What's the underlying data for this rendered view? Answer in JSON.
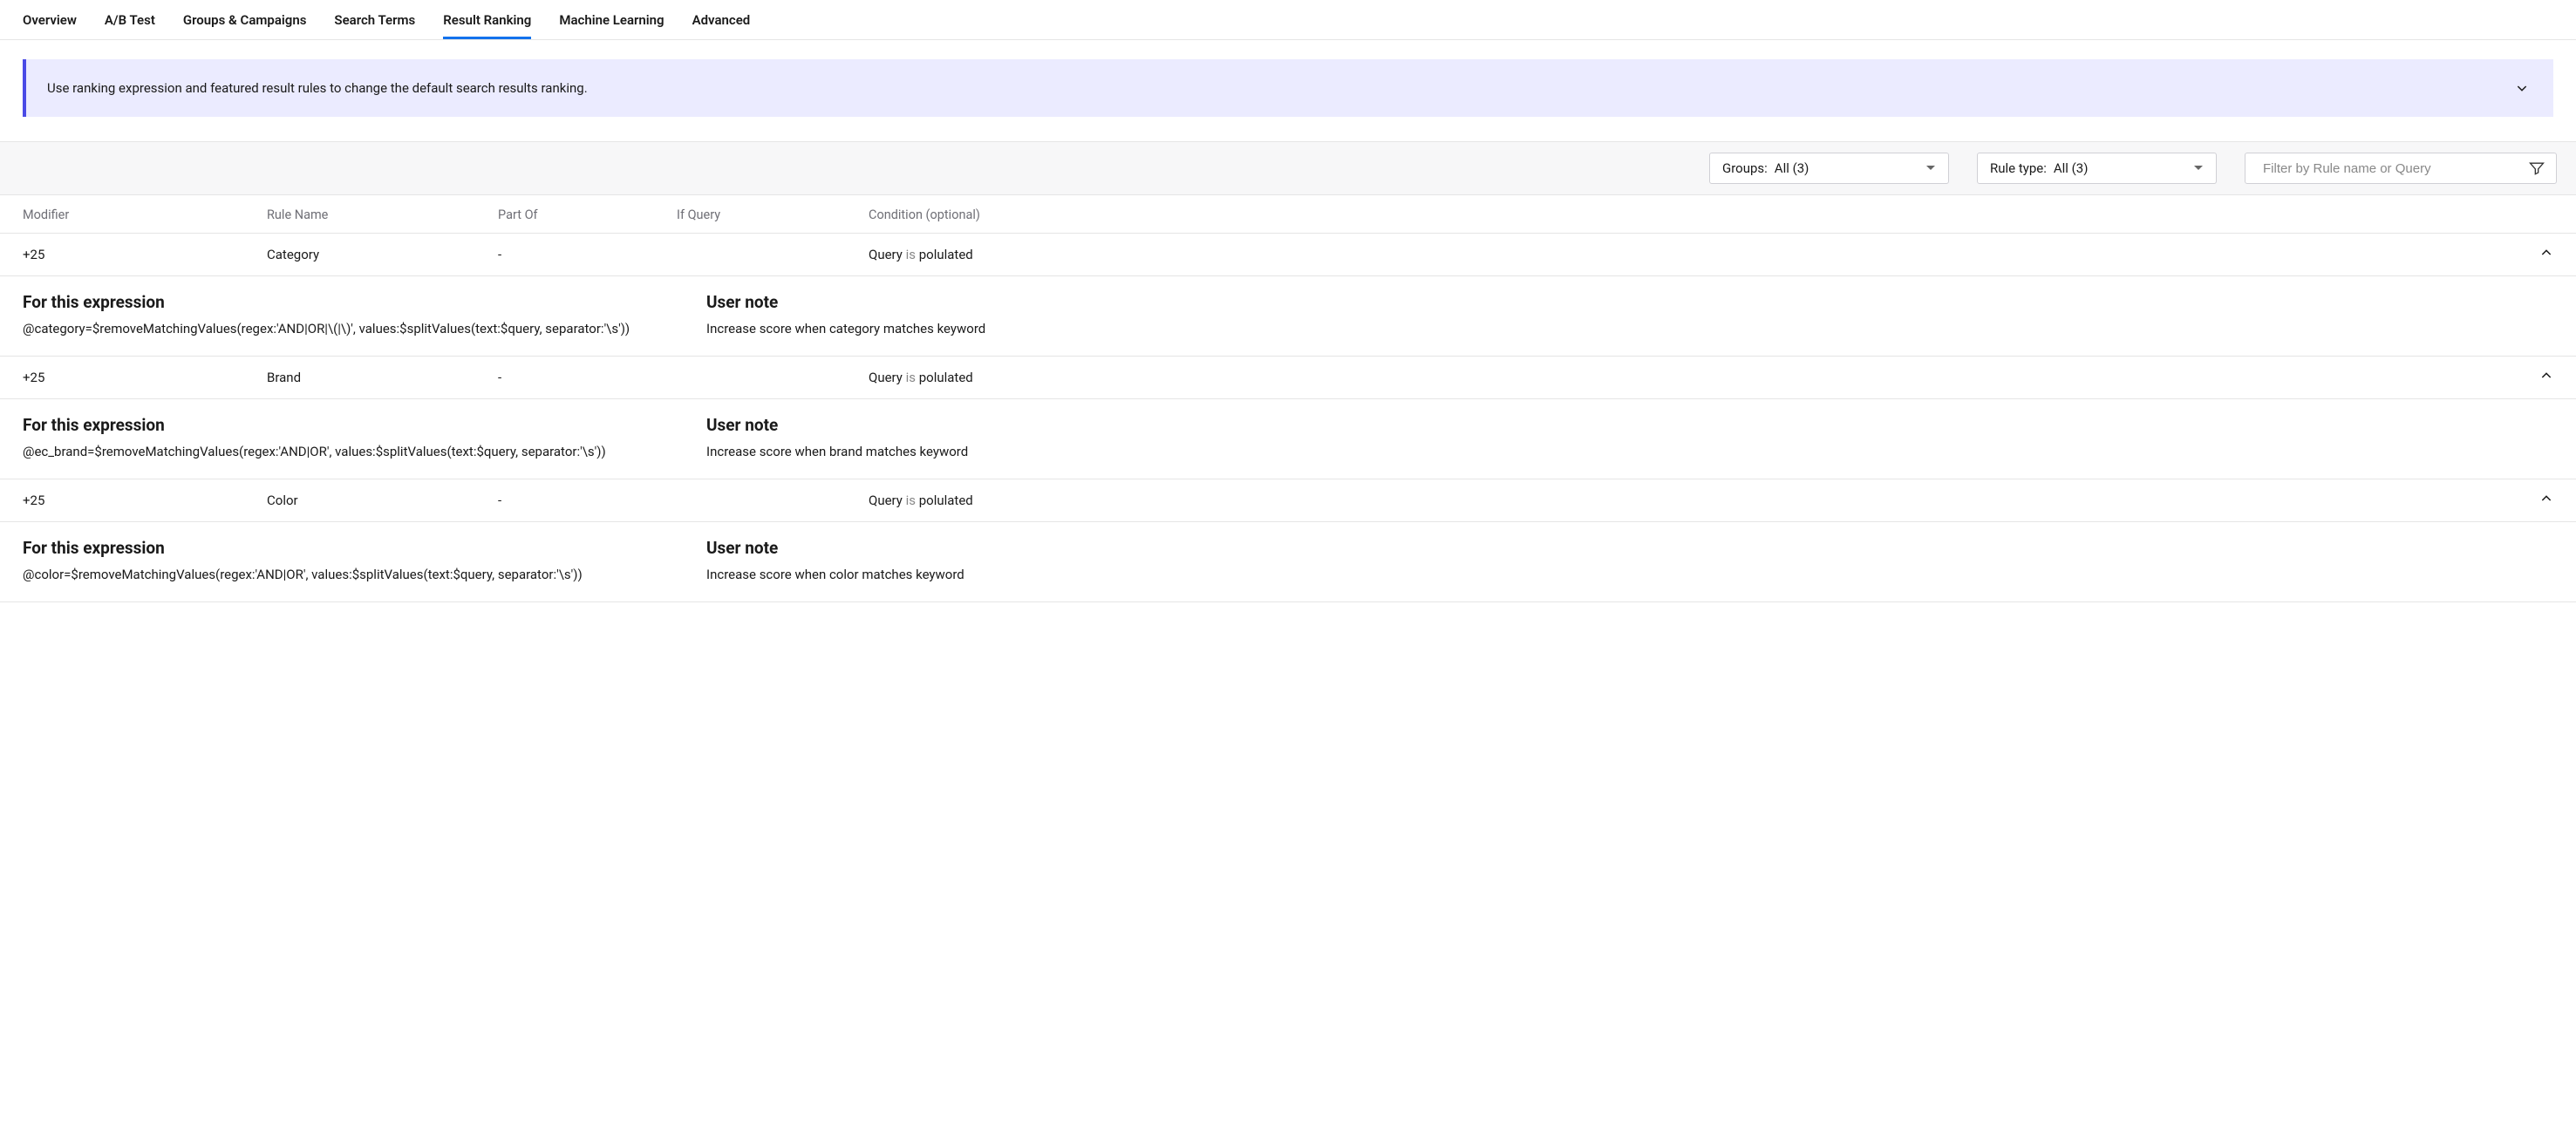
{
  "tabs": [
    "Overview",
    "A/B Test",
    "Groups & Campaigns",
    "Search Terms",
    "Result Ranking",
    "Machine Learning",
    "Advanced"
  ],
  "activeTab": "Result Ranking",
  "banner": {
    "text": "Use ranking expression and featured result rules to change the default search results ranking."
  },
  "toolbar": {
    "groupsLabel": "Groups:",
    "groupsValue": "All (3)",
    "ruleTypeLabel": "Rule type:",
    "ruleTypeValue": "All (3)",
    "filterPlaceholder": "Filter by Rule name or Query"
  },
  "columns": {
    "modifier": "Modifier",
    "ruleName": "Rule Name",
    "partOf": "Part Of",
    "ifQuery": "If Query",
    "condition": "Condition (optional)"
  },
  "detailLabels": {
    "expression": "For this expression",
    "userNote": "User note"
  },
  "rules": [
    {
      "modifier": "+25",
      "ruleName": "Category",
      "partOf": "-",
      "ifQuery": "",
      "condPrefix": "Query",
      "condIs": "is",
      "condVal": "polulated",
      "expression": "@category=$removeMatchingValues(regex:'AND|OR|\\(|\\)', values:$splitValues(text:$query, separator:'\\s'))",
      "userNote": "Increase score when category matches keyword"
    },
    {
      "modifier": "+25",
      "ruleName": "Brand",
      "partOf": "-",
      "ifQuery": "",
      "condPrefix": "Query",
      "condIs": "is",
      "condVal": "polulated",
      "expression": "@ec_brand=$removeMatchingValues(regex:'AND|OR', values:$splitValues(text:$query, separator:'\\s'))",
      "userNote": "Increase score when brand matches keyword"
    },
    {
      "modifier": "+25",
      "ruleName": "Color",
      "partOf": "-",
      "ifQuery": "",
      "condPrefix": "Query",
      "condIs": "is",
      "condVal": "polulated",
      "expression": "@color=$removeMatchingValues(regex:'AND|OR', values:$splitValues(text:$query, separator:'\\s'))",
      "userNote": "Increase score when color matches keyword"
    }
  ]
}
